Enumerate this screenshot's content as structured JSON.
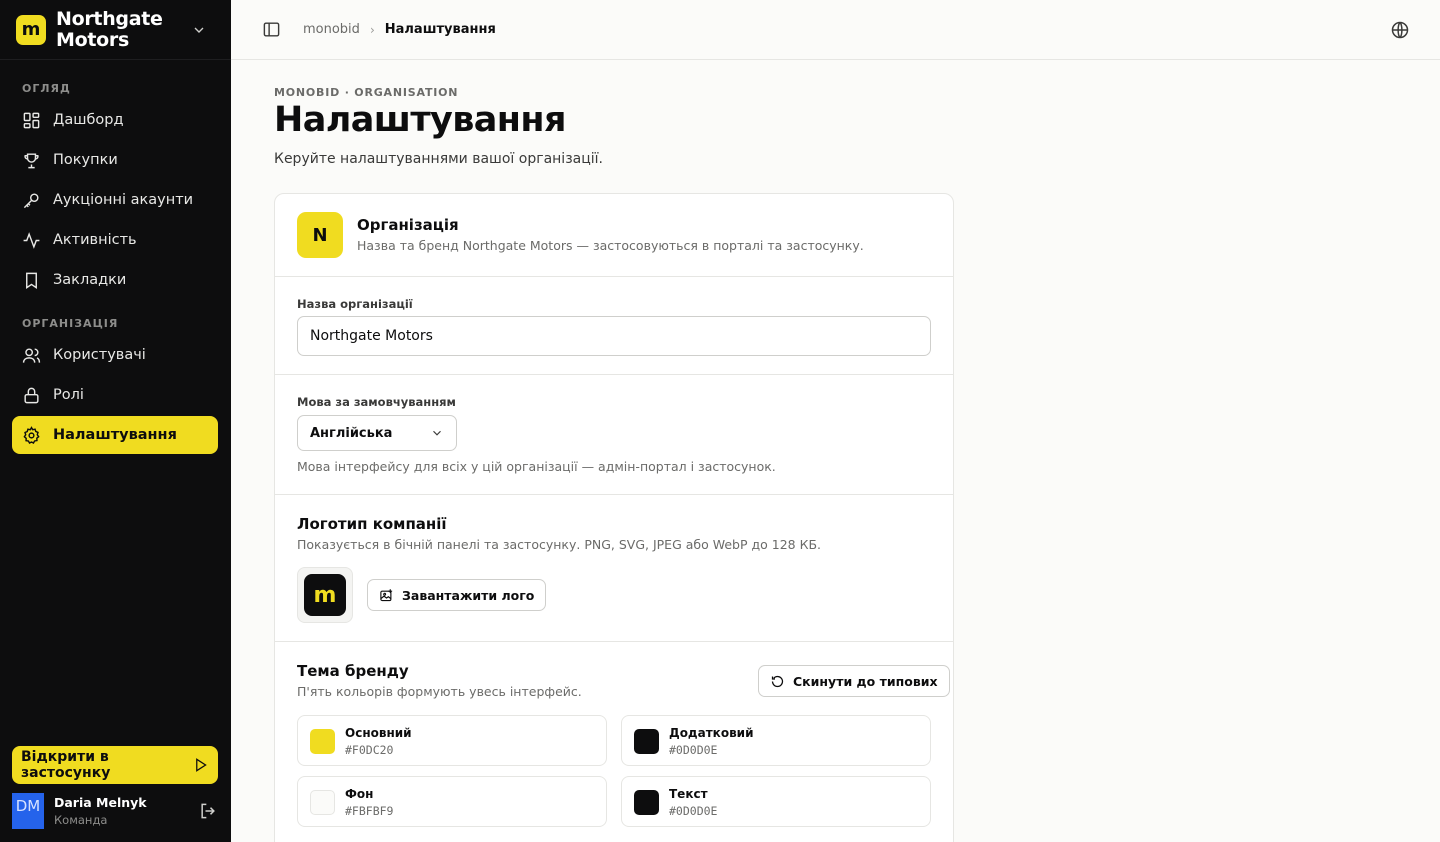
{
  "brand": {
    "logo_letter": "m",
    "name": "Northgate Motors"
  },
  "sidebar": {
    "section_overview": "ОГЛЯД",
    "section_org": "ОРГАНІЗАЦІЯ",
    "items": [
      {
        "label": "Дашборд",
        "icon": "dashboard-icon"
      },
      {
        "label": "Покупки",
        "icon": "trophy-icon"
      },
      {
        "label": "Аукціонні акаунти",
        "icon": "key-icon"
      },
      {
        "label": "Активність",
        "icon": "activity-icon"
      },
      {
        "label": "Закладки",
        "icon": "bookmark-icon"
      },
      {
        "label": "Користувачі",
        "icon": "users-icon"
      },
      {
        "label": "Ролі",
        "icon": "lock-icon"
      },
      {
        "label": "Налаштування",
        "icon": "gear-icon",
        "active": true
      }
    ],
    "open_app": "Відкрити в застосунку",
    "user": {
      "initials": "DM",
      "name": "Daria Melnyk",
      "role": "Команда"
    }
  },
  "topbar": {
    "crumb_root": "monobid",
    "crumb_sep": "›",
    "crumb_current": "Налаштування"
  },
  "page": {
    "eyebrow": "MONOBID · ORGANISATION",
    "title": "Налаштування",
    "subtitle": "Керуйте налаштуваннями вашої організації."
  },
  "org": {
    "badge": "N",
    "title": "Організація",
    "desc": "Назва та бренд Northgate Motors — застосовуються в порталі та застосунку.",
    "name_label": "Назва організації",
    "name_value": "Northgate Motors",
    "lang_label": "Мова за замовчуванням",
    "lang_value": "Англійська",
    "lang_help": "Мова інтерфейсу для всіх у цій організації — адмін-портал і застосунок."
  },
  "logo": {
    "title": "Логотип компанії",
    "desc": "Показується в бічній панелі та застосунку. PNG, SVG, JPEG або WebP до 128 КБ.",
    "preview_letter": "m",
    "upload_label": "Завантажити лого"
  },
  "theme": {
    "title": "Тема бренду",
    "desc": "П'ять кольорів формують увесь інтерфейс.",
    "reset_label": "Скинути до типових",
    "swatches": [
      {
        "name": "Основний",
        "hex": "#F0DC20",
        "color": "#F0DC20"
      },
      {
        "name": "Додатковий",
        "hex": "#0D0D0E",
        "color": "#0D0D0E"
      },
      {
        "name": "Фон",
        "hex": "#FBFBF9",
        "color": "#FBFBF9"
      },
      {
        "name": "Текст",
        "hex": "#0D0D0E",
        "color": "#0D0D0E"
      }
    ]
  },
  "colors": {
    "accent": "#F0DC20",
    "sidebar_bg": "#0D0D0E",
    "page_bg": "#FBFBF9",
    "avatar": "#2563EB"
  }
}
